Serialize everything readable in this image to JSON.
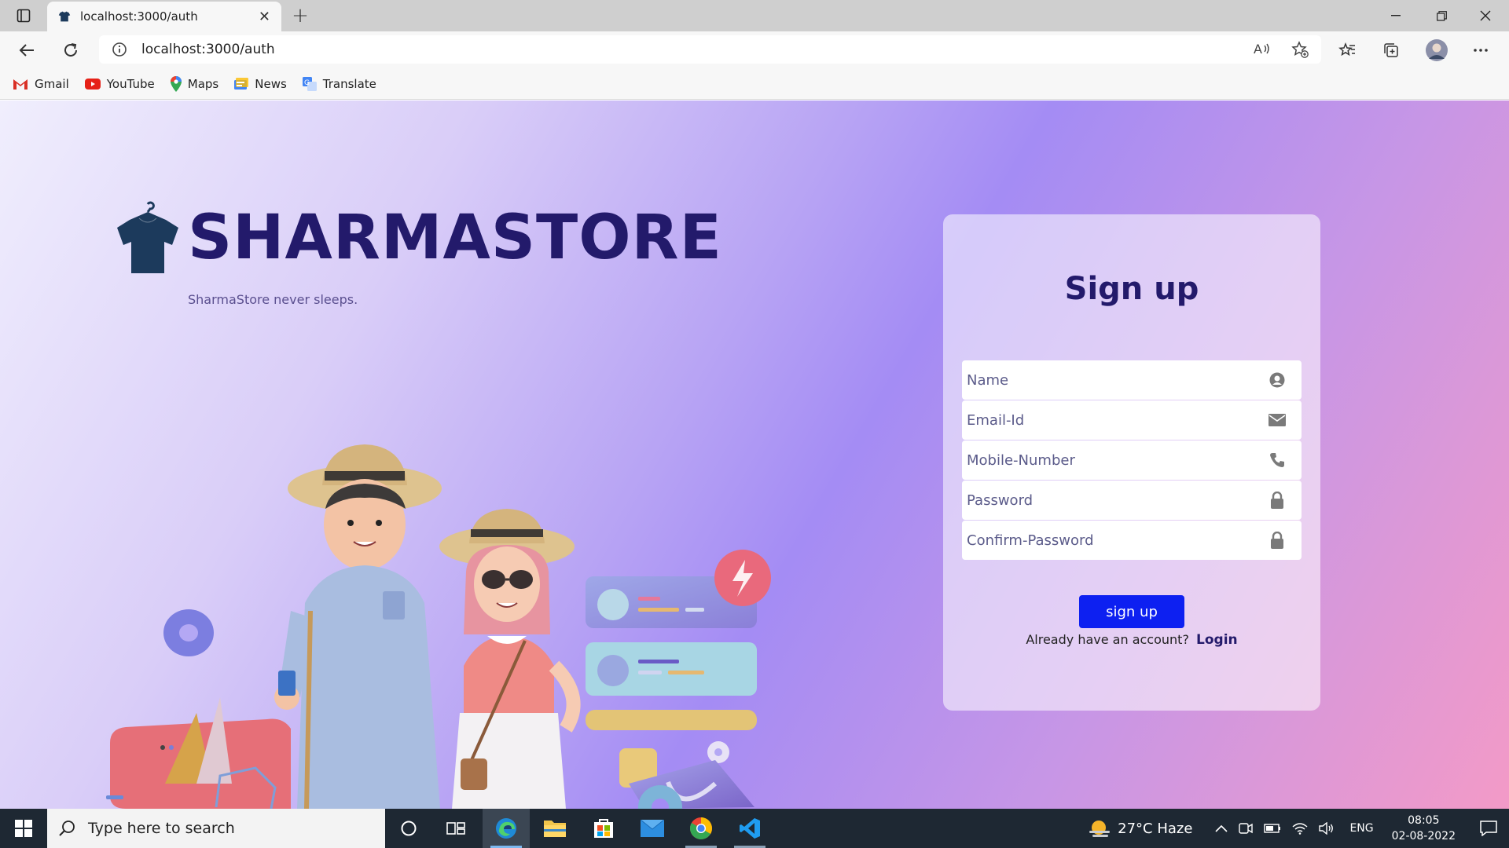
{
  "browser": {
    "tab_title": "localhost:3000/auth",
    "url": "localhost:3000/auth",
    "bookmarks": [
      {
        "label": "Gmail",
        "icon": "gmail-icon"
      },
      {
        "label": "YouTube",
        "icon": "youtube-icon"
      },
      {
        "label": "Maps",
        "icon": "maps-icon"
      },
      {
        "label": "News",
        "icon": "news-icon"
      },
      {
        "label": "Translate",
        "icon": "translate-icon"
      }
    ]
  },
  "brand": {
    "title": "SHARMASTORE",
    "tagline": "SharmaStore never sleeps."
  },
  "signup": {
    "title": "Sign up",
    "fields": [
      {
        "placeholder": "Name",
        "icon": "user-icon"
      },
      {
        "placeholder": "Email-Id",
        "icon": "envelope-icon"
      },
      {
        "placeholder": "Mobile-Number",
        "icon": "phone-icon"
      },
      {
        "placeholder": "Password",
        "icon": "lock-icon"
      },
      {
        "placeholder": "Confirm-Password",
        "icon": "lock-icon"
      }
    ],
    "button_label": "sign up",
    "login_prompt": "Already have an account?",
    "login_link": "Login"
  },
  "taskbar": {
    "search_placeholder": "Type here to search",
    "weather": "27°C  Haze",
    "language": "ENG",
    "time": "08:05",
    "date": "02-08-2022"
  },
  "colors": {
    "brand_navy": "#231a6b",
    "button_blue": "#0d20f1"
  }
}
